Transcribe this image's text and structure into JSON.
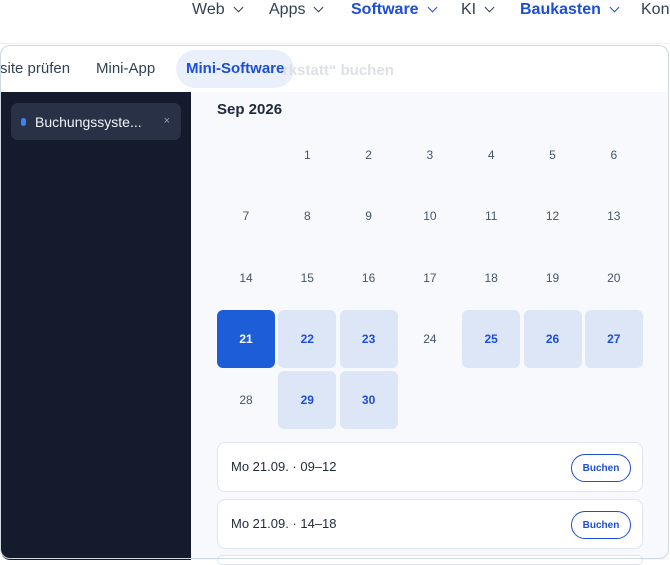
{
  "nav": {
    "items": [
      {
        "label": "Web",
        "has_chevron": true,
        "active": false
      },
      {
        "label": "Apps",
        "has_chevron": true,
        "active": false
      },
      {
        "label": "Software",
        "has_chevron": true,
        "active": true
      },
      {
        "label": "KI",
        "has_chevron": true,
        "active": false
      },
      {
        "label": "Baukasten",
        "has_chevron": true,
        "active": true
      },
      {
        "label": "Kont",
        "has_chevron": false,
        "active": false
      }
    ]
  },
  "tabs": [
    {
      "label": "site prüfen",
      "active": false
    },
    {
      "label": "Mini-App",
      "active": false
    },
    {
      "label": "Mini-Software",
      "active": true
    }
  ],
  "ghost_title": "rkstatt“ buchen",
  "sidebar": {
    "chip": {
      "label": "Buchungssyste...",
      "close": "×"
    }
  },
  "calendar": {
    "month": "Sep 2026",
    "start_col": 1,
    "days": [
      {
        "d": "1"
      },
      {
        "d": "2"
      },
      {
        "d": "3"
      },
      {
        "d": "4"
      },
      {
        "d": "5"
      },
      {
        "d": "6"
      },
      {
        "d": "7"
      },
      {
        "d": "8"
      },
      {
        "d": "9"
      },
      {
        "d": "10"
      },
      {
        "d": "11"
      },
      {
        "d": "12"
      },
      {
        "d": "13"
      },
      {
        "d": "14"
      },
      {
        "d": "15"
      },
      {
        "d": "16"
      },
      {
        "d": "17"
      },
      {
        "d": "18"
      },
      {
        "d": "19"
      },
      {
        "d": "20"
      },
      {
        "d": "21",
        "state": "selected"
      },
      {
        "d": "22",
        "state": "available"
      },
      {
        "d": "23",
        "state": "available"
      },
      {
        "d": "24"
      },
      {
        "d": "25",
        "state": "available"
      },
      {
        "d": "26",
        "state": "available"
      },
      {
        "d": "27",
        "state": "available"
      },
      {
        "d": "28"
      },
      {
        "d": "29",
        "state": "available"
      },
      {
        "d": "30",
        "state": "available"
      }
    ]
  },
  "slots": [
    {
      "label": "Mo 21.09. · 09–12",
      "button": "Buchen"
    },
    {
      "label": "Mo 21.09. · 14–18",
      "button": "Buchen"
    }
  ],
  "colors": {
    "accent": "#1d4ed8",
    "sidebar_bg": "#141b2d",
    "available_bg": "#dde6f6",
    "selected_bg": "#1d5ed8"
  }
}
